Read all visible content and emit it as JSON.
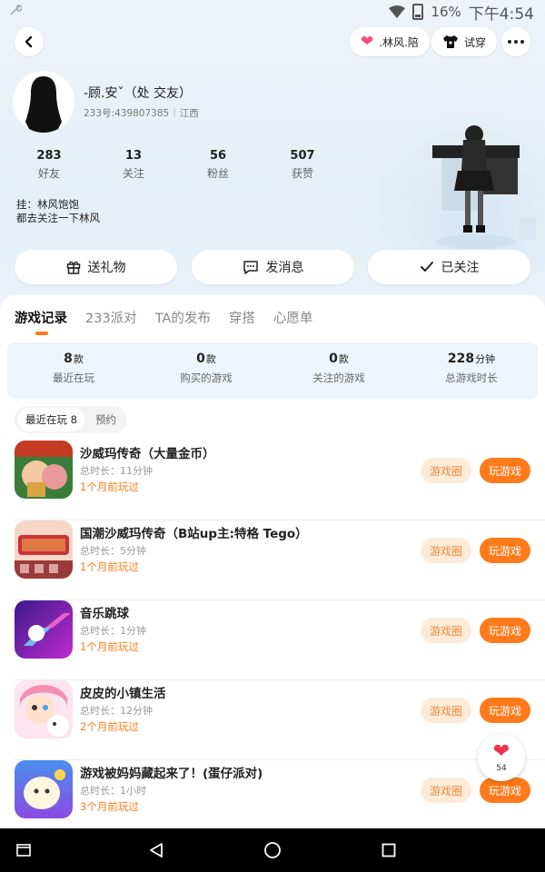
{
  "status": {
    "battery": "16%",
    "time": "下午4:54"
  },
  "header": {
    "back": "back",
    "vip_label": ".林风.陪",
    "tryon_label": "试穿"
  },
  "profile": {
    "nickname": "-顾.安ˇ（处 交友）",
    "uid": "233号:439807385",
    "location": "江西",
    "stats": [
      {
        "num": "283",
        "label": "好友"
      },
      {
        "num": "13",
        "label": "关注"
      },
      {
        "num": "56",
        "label": "粉丝"
      },
      {
        "num": "507",
        "label": "获赞"
      }
    ],
    "bio_line1": "挂：林风饱饱",
    "bio_line2": "都去关注一下林风"
  },
  "actions": {
    "gift": "送礼物",
    "message": "发消息",
    "followed": "已关注"
  },
  "tabs": [
    "游戏记录",
    "233派对",
    "TA的发布",
    "穿搭",
    "心愿单"
  ],
  "summary": [
    {
      "num": "8",
      "unit": "款",
      "label": "最近在玩"
    },
    {
      "num": "0",
      "unit": "款",
      "label": "购买的游戏"
    },
    {
      "num": "0",
      "unit": "款",
      "label": "关注的游戏"
    },
    {
      "num": "228",
      "unit": "分钟",
      "label": "总游戏时长"
    }
  ],
  "subtabs": {
    "recent": "最近在玩 8",
    "reserve": "预约"
  },
  "games": [
    {
      "name": "沙威玛传奇（大量金币）",
      "time": "总时长：11分钟",
      "last": "1个月前玩过"
    },
    {
      "name": "国潮沙威玛传奇（B站up主:特格 Tego）",
      "time": "总时长：5分钟",
      "last": "1个月前玩过"
    },
    {
      "name": "音乐跳球",
      "time": "总时长：1分钟",
      "last": "1个月前玩过"
    },
    {
      "name": "皮皮的小镇生活",
      "time": "总时长：12分钟",
      "last": "2个月前玩过"
    },
    {
      "name": "游戏被妈妈藏起来了！(蛋仔派对)",
      "time": "总时长：1小时",
      "last": "3个月前玩过"
    }
  ],
  "game_buttons": {
    "circle": "游戏圈",
    "play": "玩游戏"
  },
  "like_count": "54",
  "colors": {
    "accent": "#ff7a1a",
    "accent_soft": "#fdebd9",
    "heart": "#f0304f"
  }
}
